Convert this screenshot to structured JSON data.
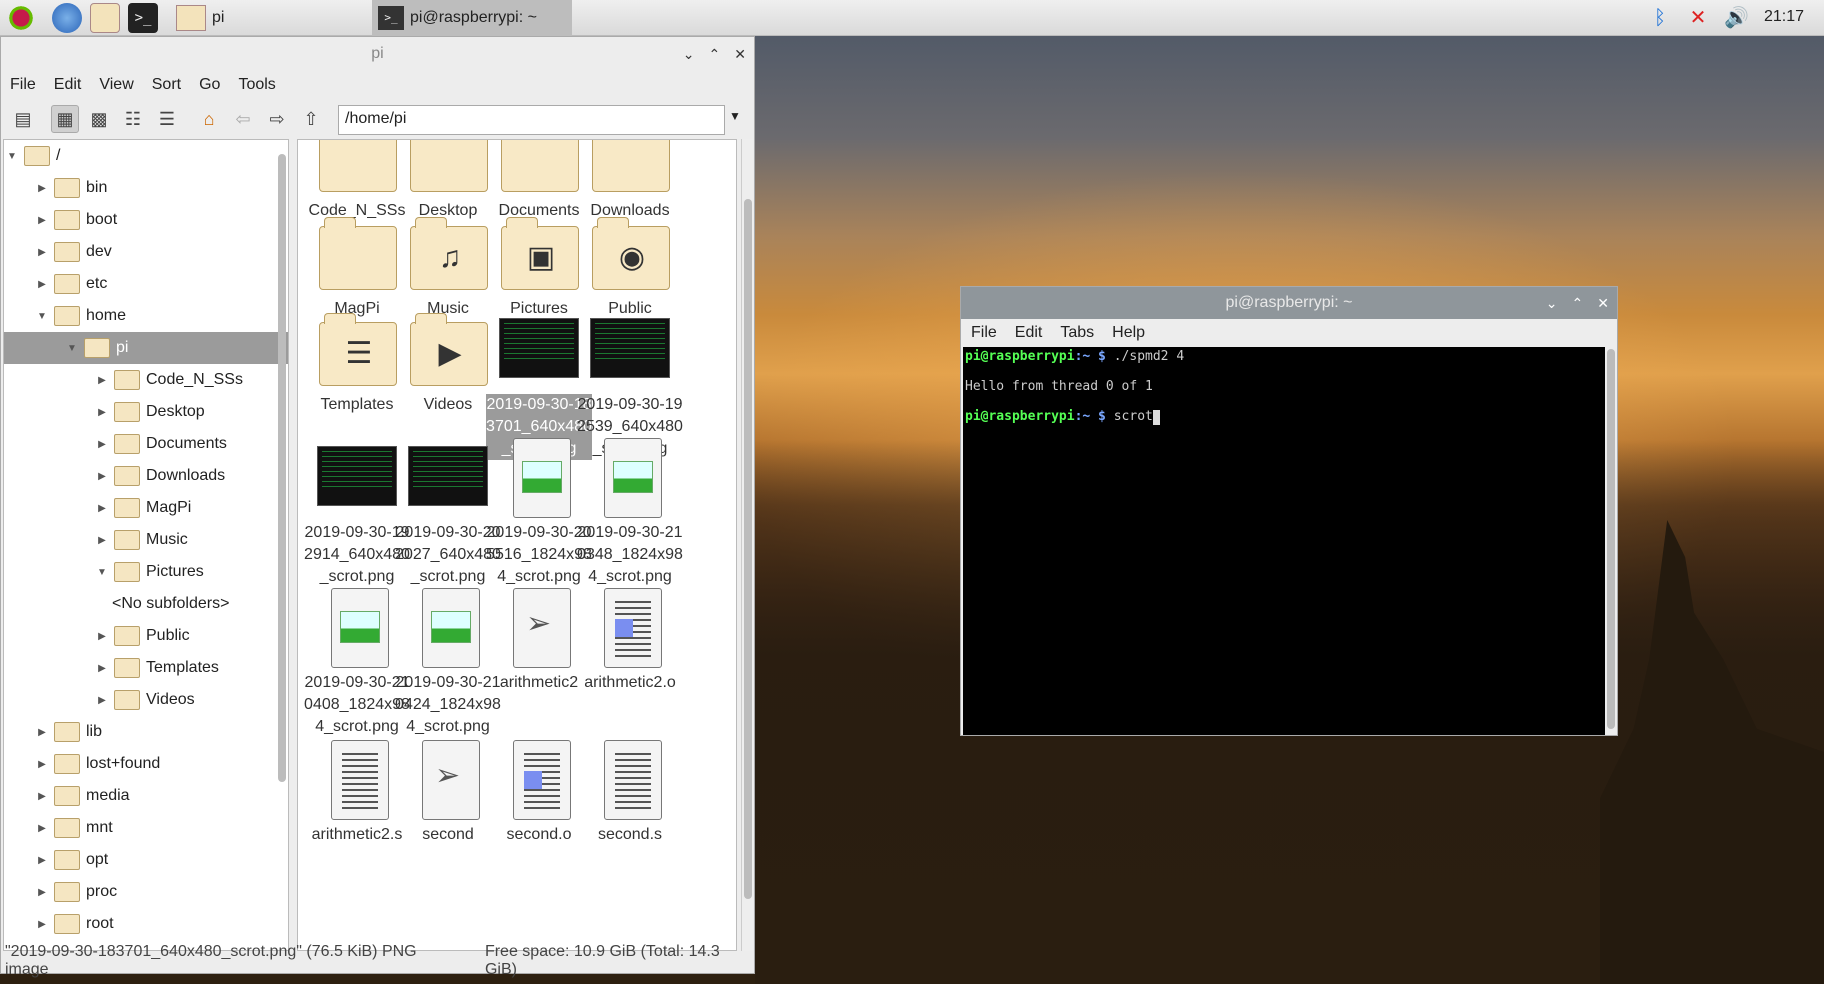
{
  "taskbar": {
    "tasks": [
      {
        "label": "pi",
        "active": false
      },
      {
        "label": "pi@raspberrypi: ~",
        "active": true
      }
    ],
    "clock": "21:17",
    "icons": [
      "raspberry-menu-icon",
      "browser-icon",
      "file-manager-icon",
      "terminal-icon"
    ],
    "tray": [
      "bluetooth-icon",
      "network-disconnected-icon",
      "volume-icon"
    ]
  },
  "filemanager": {
    "title": "pi",
    "menu": [
      "File",
      "Edit",
      "View",
      "Sort",
      "Go",
      "Tools"
    ],
    "path": "/home/pi",
    "tree": [
      {
        "label": "/",
        "depth": 0,
        "expanded": true
      },
      {
        "label": "bin",
        "depth": 1
      },
      {
        "label": "boot",
        "depth": 1
      },
      {
        "label": "dev",
        "depth": 1
      },
      {
        "label": "etc",
        "depth": 1
      },
      {
        "label": "home",
        "depth": 1,
        "expanded": true
      },
      {
        "label": "pi",
        "depth": 2,
        "expanded": true,
        "selected": true
      },
      {
        "label": "Code_N_SSs",
        "depth": 3
      },
      {
        "label": "Desktop",
        "depth": 3
      },
      {
        "label": "Documents",
        "depth": 3
      },
      {
        "label": "Downloads",
        "depth": 3
      },
      {
        "label": "MagPi",
        "depth": 3
      },
      {
        "label": "Music",
        "depth": 3
      },
      {
        "label": "Pictures",
        "depth": 3,
        "expanded": true
      },
      {
        "label": "<No subfolders>",
        "depth": 4,
        "placeholder": true
      },
      {
        "label": "Public",
        "depth": 3
      },
      {
        "label": "Templates",
        "depth": 3
      },
      {
        "label": "Videos",
        "depth": 3
      },
      {
        "label": "lib",
        "depth": 1
      },
      {
        "label": "lost+found",
        "depth": 1
      },
      {
        "label": "media",
        "depth": 1
      },
      {
        "label": "mnt",
        "depth": 1
      },
      {
        "label": "opt",
        "depth": 1
      },
      {
        "label": "proc",
        "depth": 1
      },
      {
        "label": "root",
        "depth": 1
      }
    ],
    "files": [
      {
        "label": "Code_N_SSs",
        "kind": "folder"
      },
      {
        "label": "Desktop",
        "kind": "folder"
      },
      {
        "label": "Documents",
        "kind": "folder"
      },
      {
        "label": "Downloads",
        "kind": "folder"
      },
      {
        "label": "MagPi",
        "kind": "folder"
      },
      {
        "label": "Music",
        "kind": "folder",
        "emblem": "♫"
      },
      {
        "label": "Pictures",
        "kind": "folder",
        "emblem": "▣"
      },
      {
        "label": "Public",
        "kind": "folder",
        "emblem": "◉"
      },
      {
        "label": "Templates",
        "kind": "folder",
        "emblem": "☰"
      },
      {
        "label": "Videos",
        "kind": "folder",
        "emblem": "▶"
      },
      {
        "label": "2019-09-30-183701_640x480_scrot.png",
        "kind": "thumb",
        "selected": true
      },
      {
        "label": "2019-09-30-192539_640x480_scrot.png",
        "kind": "thumb"
      },
      {
        "label": "2019-09-30-192914_640x480_scrot.png",
        "kind": "thumb"
      },
      {
        "label": "2019-09-30-202027_640x480_scrot.png",
        "kind": "thumb"
      },
      {
        "label": "2019-09-30-205516_1824x984_scrot.png",
        "kind": "image"
      },
      {
        "label": "2019-09-30-210348_1824x984_scrot.png",
        "kind": "image"
      },
      {
        "label": "2019-09-30-210408_1824x984_scrot.png",
        "kind": "image"
      },
      {
        "label": "2019-09-30-210424_1824x984_scrot.png",
        "kind": "image"
      },
      {
        "label": "arithmetic2",
        "kind": "exec"
      },
      {
        "label": "arithmetic2.o",
        "kind": "object"
      },
      {
        "label": "arithmetic2.s",
        "kind": "text"
      },
      {
        "label": "second",
        "kind": "exec"
      },
      {
        "label": "second.o",
        "kind": "object"
      },
      {
        "label": "second.s",
        "kind": "text"
      }
    ],
    "status": {
      "selection": "\"2019-09-30-183701_640x480_scrot.png\" (76.5 KiB) PNG image",
      "free": "Free space: 10.9 GiB (Total: 14.3 GiB)"
    }
  },
  "terminal": {
    "title": "pi@raspberrypi: ~",
    "menu": [
      "File",
      "Edit",
      "Tabs",
      "Help"
    ],
    "lines": [
      {
        "prompt_user": "pi@raspberrypi",
        "prompt_path": ":~ $",
        "cmd": " ./spmd2 4"
      },
      {
        "text": ""
      },
      {
        "text": "Hello from thread 0 of 1"
      },
      {
        "text": ""
      },
      {
        "prompt_user": "pi@raspberrypi",
        "prompt_path": ":~ $",
        "cmd": " scrot",
        "cursor": true
      }
    ]
  }
}
